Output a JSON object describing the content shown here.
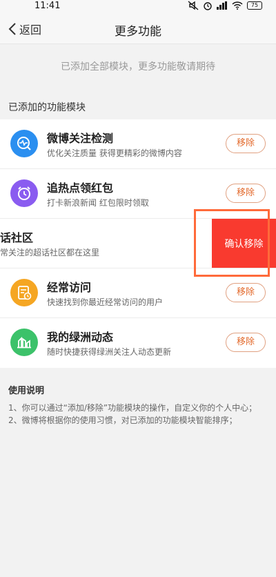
{
  "status_bar": {
    "time": "11:41",
    "battery": "75"
  },
  "nav": {
    "back_label": "返回",
    "title": "更多功能"
  },
  "notice": "已添加全部模块，更多功能敬请期待",
  "section_label": "已添加的功能模块",
  "modules": [
    {
      "title": "微博关注检测",
      "desc": "优化关注质量 获得更精彩的微博内容",
      "remove": "移除",
      "icon": "pulse-icon",
      "color": "#2b8ff0"
    },
    {
      "title": "追热点领红包",
      "desc": "打卡新浪新闻 红包限时领取",
      "remove": "移除",
      "icon": "alarm-clock-icon",
      "color": "#8a5cf0"
    },
    {
      "title": "话社区",
      "desc": "常关注的超话社区都在这里",
      "confirm": "确认移除"
    },
    {
      "title": "经常访问",
      "desc": "快速找到你最近经常访问的用户",
      "remove": "移除",
      "icon": "recent-visit-icon",
      "color": "#f5a623"
    },
    {
      "title": "我的绿洲动态",
      "desc": "随时快捷获得绿洲关注人动态更新",
      "remove": "移除",
      "icon": "oasis-icon",
      "color": "#3cc26a"
    }
  ],
  "usage": {
    "title": "使用说明",
    "lines": [
      "1、你可以通过“添加/移除”功能模块的操作，自定义你的个人中心；",
      "2、微博将根据你的使用习惯，对已添加的功能模块智能排序；"
    ]
  }
}
